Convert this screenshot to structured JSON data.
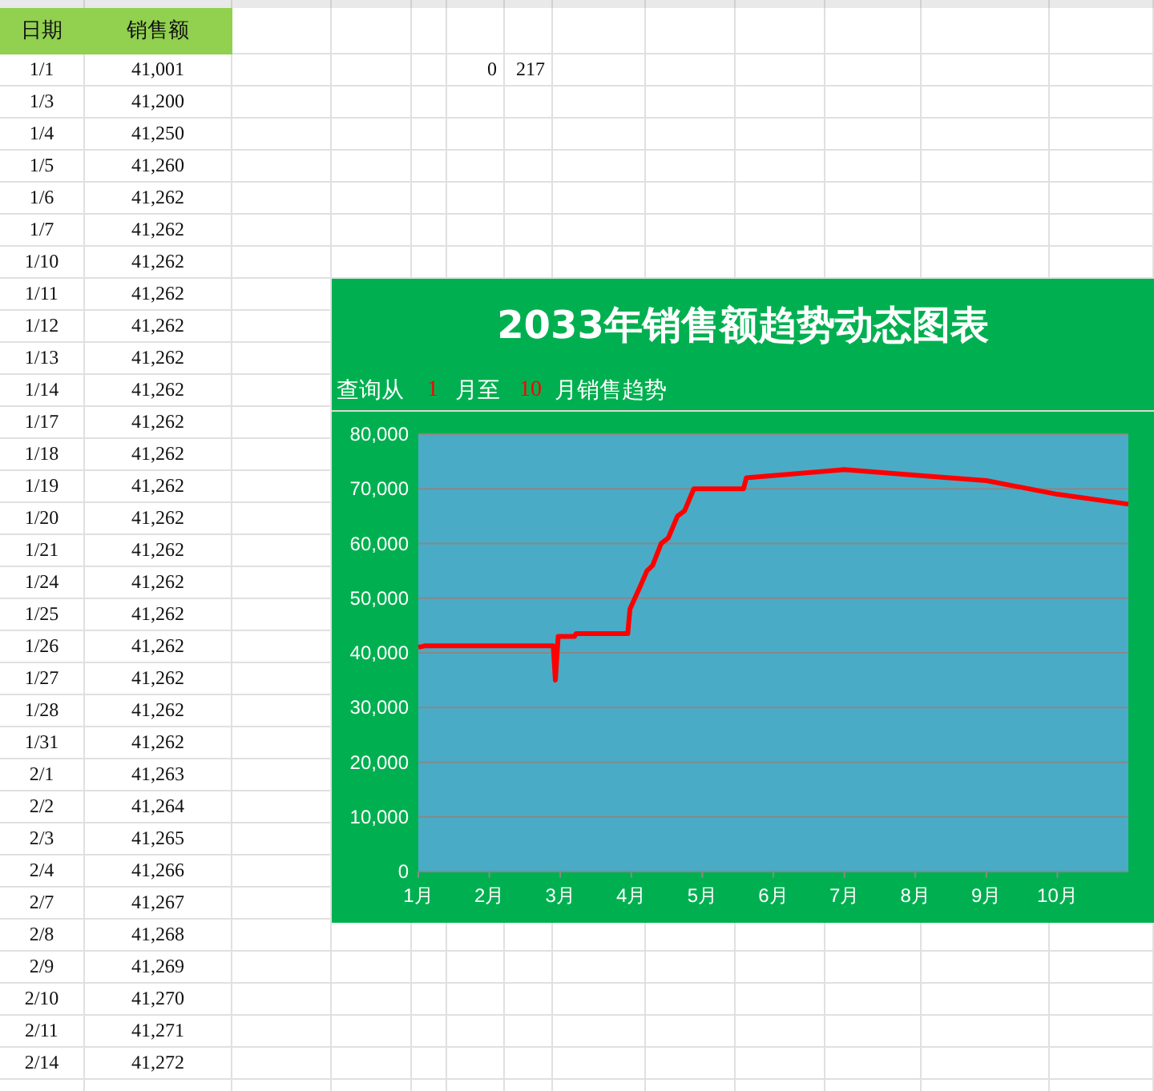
{
  "sheet": {
    "headers": [
      "日期",
      "销售额"
    ],
    "rows": [
      {
        "date": "1/1",
        "sales": "41,001",
        "extra": [
          "0",
          "217"
        ]
      },
      {
        "date": "1/3",
        "sales": "41,200"
      },
      {
        "date": "1/4",
        "sales": "41,250"
      },
      {
        "date": "1/5",
        "sales": "41,260"
      },
      {
        "date": "1/6",
        "sales": "41,262"
      },
      {
        "date": "1/7",
        "sales": "41,262"
      },
      {
        "date": "1/10",
        "sales": "41,262"
      },
      {
        "date": "1/11",
        "sales": "41,262"
      },
      {
        "date": "1/12",
        "sales": "41,262"
      },
      {
        "date": "1/13",
        "sales": "41,262"
      },
      {
        "date": "1/14",
        "sales": "41,262"
      },
      {
        "date": "1/17",
        "sales": "41,262"
      },
      {
        "date": "1/18",
        "sales": "41,262"
      },
      {
        "date": "1/19",
        "sales": "41,262"
      },
      {
        "date": "1/20",
        "sales": "41,262"
      },
      {
        "date": "1/21",
        "sales": "41,262"
      },
      {
        "date": "1/24",
        "sales": "41,262"
      },
      {
        "date": "1/25",
        "sales": "41,262"
      },
      {
        "date": "1/26",
        "sales": "41,262"
      },
      {
        "date": "1/27",
        "sales": "41,262"
      },
      {
        "date": "1/28",
        "sales": "41,262"
      },
      {
        "date": "1/31",
        "sales": "41,262"
      },
      {
        "date": "2/1",
        "sales": "41,263"
      },
      {
        "date": "2/2",
        "sales": "41,264"
      },
      {
        "date": "2/3",
        "sales": "41,265"
      },
      {
        "date": "2/4",
        "sales": "41,266"
      },
      {
        "date": "2/7",
        "sales": "41,267"
      },
      {
        "date": "2/8",
        "sales": "41,268"
      },
      {
        "date": "2/9",
        "sales": "41,269"
      },
      {
        "date": "2/10",
        "sales": "41,270"
      },
      {
        "date": "2/11",
        "sales": "41,271"
      },
      {
        "date": "2/14",
        "sales": "41,272"
      }
    ]
  },
  "chart": {
    "title": "2033年销售额趋势动态图表",
    "query": {
      "prefix": "查询从",
      "from": "1",
      "middle": "月至",
      "to": "10",
      "suffix": "月销售趋势"
    },
    "chart_data": {
      "type": "line",
      "x": [
        1,
        1.1,
        2.9,
        2.93,
        2.97,
        3.2,
        3.22,
        3.95,
        3.98,
        4.05,
        4.12,
        4.22,
        4.3,
        4.42,
        4.52,
        4.65,
        4.75,
        4.88,
        5.58,
        5.62,
        7,
        8,
        9,
        10,
        11
      ],
      "grid": true,
      "series": [
        {
          "color": "#ff0000",
          "values": [
            41000,
            41300,
            41300,
            35000,
            43000,
            43000,
            43500,
            43500,
            48000,
            50000,
            52000,
            55000,
            56000,
            60000,
            61000,
            65000,
            66000,
            70000,
            70000,
            72000,
            73500,
            72500,
            71500,
            69000,
            67200
          ]
        }
      ],
      "xlim": [
        1,
        11
      ],
      "ylim": [
        0,
        80000
      ],
      "xticks": [
        {
          "value": 1,
          "label": "1月"
        },
        {
          "value": 2,
          "label": "2月"
        },
        {
          "value": 3,
          "label": "3月"
        },
        {
          "value": 4,
          "label": "4月"
        },
        {
          "value": 5,
          "label": "5月"
        },
        {
          "value": 6,
          "label": "6月"
        },
        {
          "value": 7,
          "label": "7月"
        },
        {
          "value": 8,
          "label": "8月"
        },
        {
          "value": 9,
          "label": "9月"
        },
        {
          "value": 10,
          "label": "10月"
        }
      ],
      "yticks": [
        {
          "value": 0,
          "label": "0"
        },
        {
          "value": 10000,
          "label": "10,000"
        },
        {
          "value": 20000,
          "label": "20,000"
        },
        {
          "value": 30000,
          "label": "30,000"
        },
        {
          "value": 40000,
          "label": "40,000"
        },
        {
          "value": 50000,
          "label": "50,000"
        },
        {
          "value": 60000,
          "label": "60,000"
        },
        {
          "value": 70000,
          "label": "70,000"
        },
        {
          "value": 80000,
          "label": "80,000"
        }
      ]
    }
  }
}
